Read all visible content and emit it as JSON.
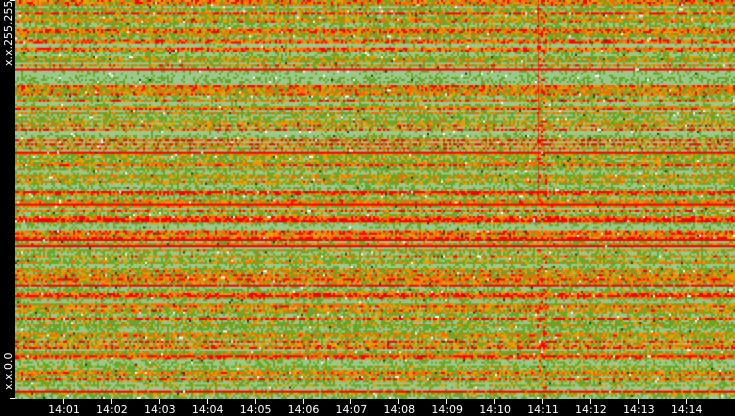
{
  "chart_data": {
    "type": "heatmap",
    "title": "",
    "xlabel": "",
    "ylabel": "",
    "y_labels": [
      "x.x.255.255",
      "x.x.0.0"
    ],
    "x_ticks": [
      "14:01",
      "14:02",
      "14:03",
      "14:04",
      "14:05",
      "14:06",
      "14:07",
      "14:08",
      "14:09",
      "14:10",
      "14:11",
      "14:12",
      "14:13",
      "14:14"
    ],
    "x_range_minutes": [
      0,
      15
    ],
    "rows": 192,
    "columns": 360,
    "color_scale": [
      {
        "level": "very low",
        "color": "#ffffff"
      },
      {
        "level": "low",
        "color": "#9cc98c"
      },
      {
        "level": "medium-low",
        "color": "#6aa82a"
      },
      {
        "level": "medium",
        "color": "#e6a000"
      },
      {
        "level": "high",
        "color": "#ff6a00"
      },
      {
        "level": "very high",
        "color": "#ff0000"
      },
      {
        "level": "anomaly",
        "color": "#2a3a10"
      }
    ],
    "seed": 7331
  }
}
